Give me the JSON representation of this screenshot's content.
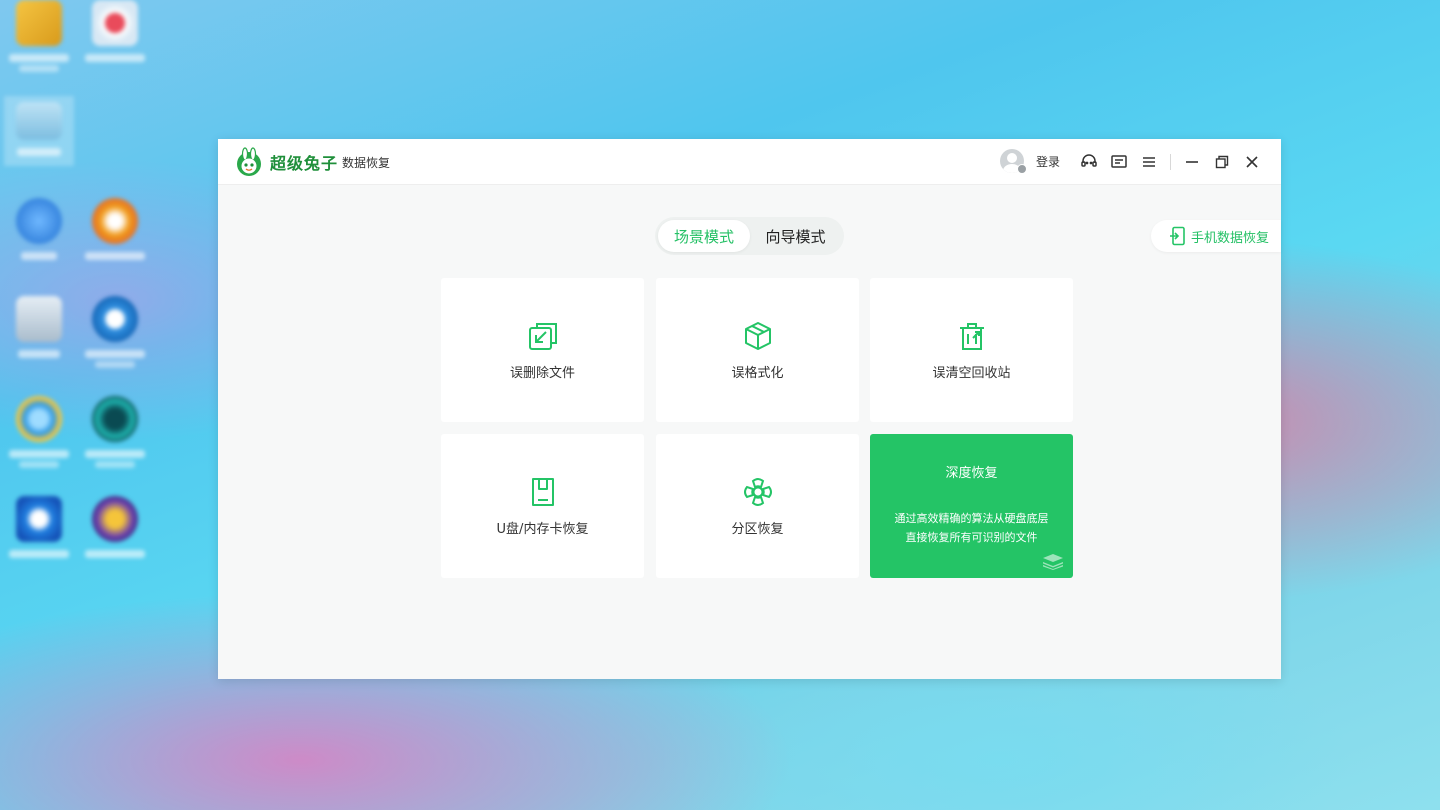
{
  "app": {
    "brand_name": "超级兔子",
    "brand_sub": "数据恢复",
    "login_label": "登录"
  },
  "modes": {
    "scene": "场景模式",
    "wizard": "向导模式"
  },
  "phone_recovery_label": "手机数据恢复",
  "cards": [
    {
      "label": "误删除文件",
      "icon": "file-recover-icon"
    },
    {
      "label": "误格式化",
      "icon": "cube-icon"
    },
    {
      "label": "误清空回收站",
      "icon": "recycle-bin-icon"
    },
    {
      "label": "U盘/内存卡恢复",
      "icon": "sd-card-icon"
    },
    {
      "label": "分区恢复",
      "icon": "partition-icon"
    }
  ],
  "deep": {
    "title": "深度恢复",
    "desc_line1": "通过高效精确的算法从硬盘底层",
    "desc_line2": "直接恢复所有可识别的文件"
  },
  "colors": {
    "accent": "#24c466",
    "window_bg": "#f7f8f8"
  }
}
